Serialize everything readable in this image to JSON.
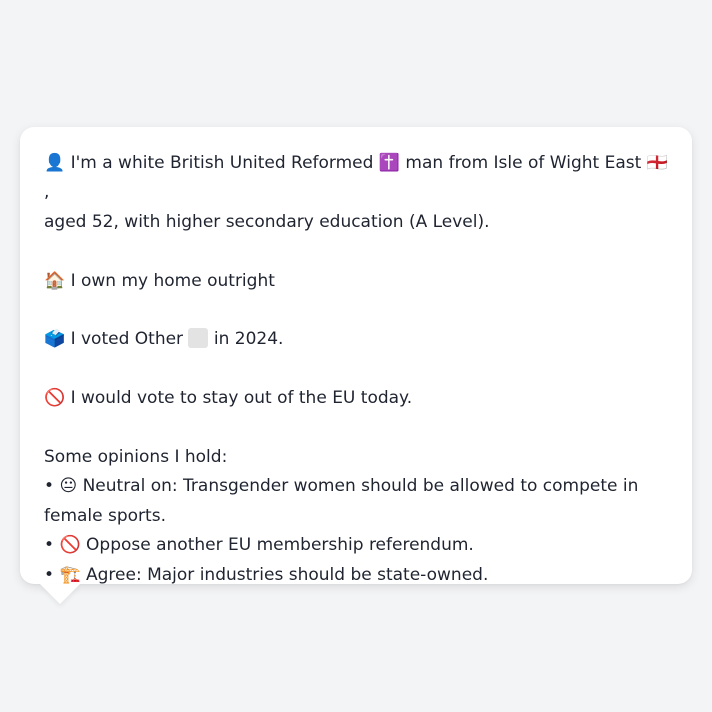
{
  "profile": {
    "identity": {
      "icon": "person-silhouette-icon",
      "text_before_religion": "I'm a white British United Reformed",
      "religion_icon": "latin-cross-icon",
      "text_before_flag": "man from Isle of Wight East",
      "flag_icon": "england-flag-icon",
      "text_after_flag": ",",
      "line2": "aged 52, with higher secondary education (A Level)."
    },
    "home": {
      "icon": "house-icon",
      "text": "I own my home outright"
    },
    "vote": {
      "icon": "ballot-box-icon",
      "text_before": "I voted Other",
      "party_icon": "blank-square-icon",
      "text_after": "in 2024."
    },
    "eu": {
      "icon": "prohibited-icon",
      "text": "I would vote to stay out of the EU today."
    }
  },
  "opinions": {
    "heading": "Some opinions I hold:",
    "items": [
      {
        "bullet": "•",
        "icon": "neutral-face-icon",
        "text": "Neutral on: Transgender women should be allowed to compete in female sports."
      },
      {
        "bullet": "•",
        "icon": "prohibited-icon",
        "text": "Oppose another EU membership referendum."
      },
      {
        "bullet": "•",
        "icon": "construction-crane-icon",
        "text": "Agree: Major industries should be state-owned."
      }
    ]
  },
  "colors": {
    "background": "#f3f4f6",
    "card": "#ffffff",
    "text": "#1f2430"
  }
}
